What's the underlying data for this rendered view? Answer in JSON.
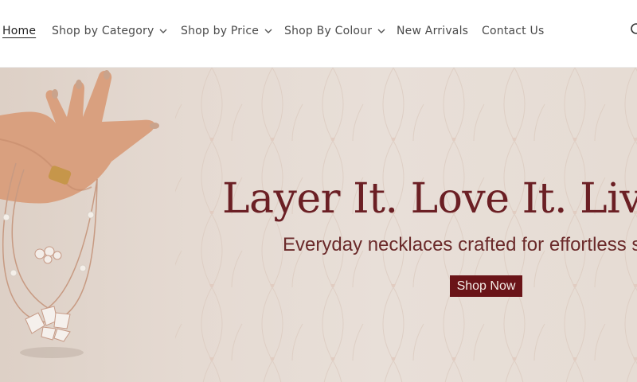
{
  "nav": {
    "items": [
      {
        "label": "Home"
      },
      {
        "label": "Shop by Category"
      },
      {
        "label": "Shop by Price"
      },
      {
        "label": "Shop By Colour"
      },
      {
        "label": "New Arrivals"
      },
      {
        "label": "Contact Us"
      }
    ],
    "icons": {
      "dropdown": "chevron-down-icon",
      "search": "search-icon"
    }
  },
  "hero": {
    "title": "Layer It. Love It. Live",
    "subtitle": "Everyday necklaces crafted for effortless s",
    "cta_label": "Shop Now"
  },
  "colors": {
    "accent": "#6a1418",
    "title_text": "#6b1f24",
    "hero_background": "#e6dcd4"
  }
}
